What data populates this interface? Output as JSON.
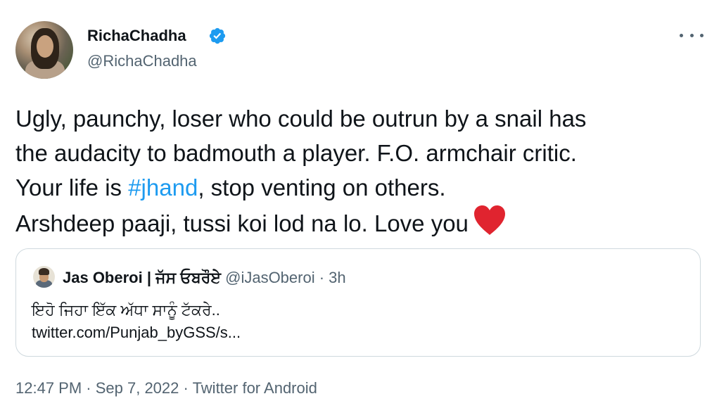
{
  "author": {
    "display_name": "RichaChadha",
    "handle": "@RichaChadha"
  },
  "tweet": {
    "line1": "Ugly, paunchy, loser who could be outrun by a snail has",
    "line2": "the audacity to badmouth a player. F.O. armchair critic.",
    "line3_before": "Your life is ",
    "hashtag": "#jhand",
    "line3_after": ", stop venting on others.",
    "line4": "Arshdeep paaji, tussi koi lod na lo. Love you"
  },
  "quoted": {
    "display_name": "Jas Oberoi | ਜੱਸ ਓਬਰੌਏ",
    "handle": "@iJasOberoi",
    "separator": " · ",
    "time": "3h",
    "text": "ਇਹੋ ਜਿਹਾ ਇੱਕ ਅੱਧਾ ਸਾਨੂੰ ਟੱਕਰੇ..",
    "link": "twitter.com/Punjab_byGSS/s..."
  },
  "meta": {
    "time": "12:47 PM",
    "separator": " · ",
    "date": "Sep 7, 2022",
    "source": "Twitter for Android"
  },
  "icons": {
    "verified": "verified-badge-icon",
    "more": "more-options-icon",
    "heart": "red-heart-emoji-icon"
  },
  "colors": {
    "accent": "#1d9bf0",
    "secondary_text": "#536471",
    "heart": "#e0242f",
    "border": "#cfd9de"
  }
}
